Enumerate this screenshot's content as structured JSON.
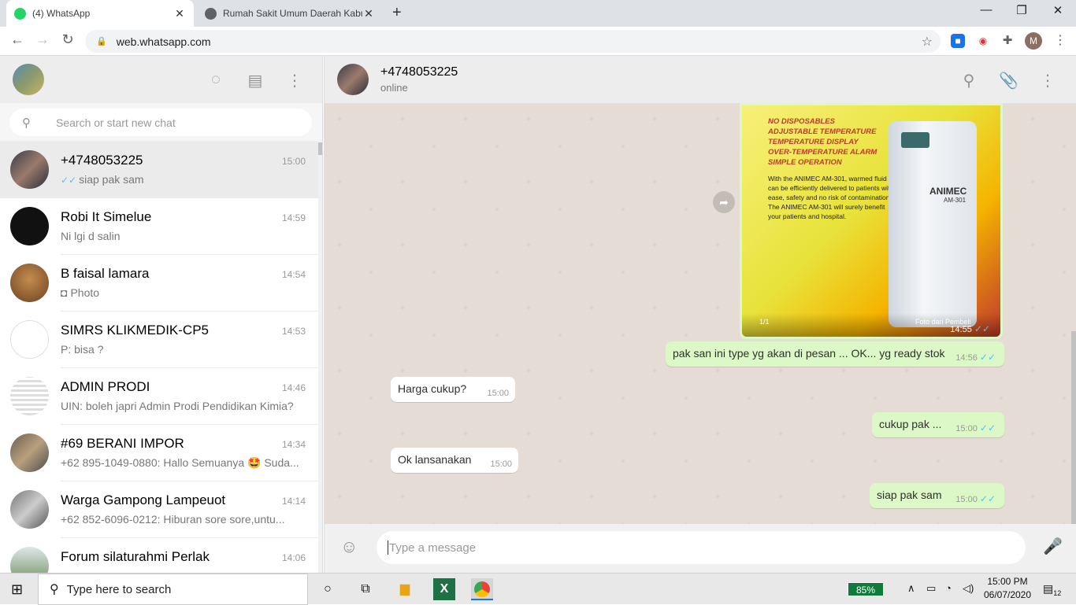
{
  "browser": {
    "tabs": [
      {
        "title": "(4) WhatsApp",
        "active": true
      },
      {
        "title": "Rumah Sakit Umum Daerah Kabu",
        "active": false
      }
    ],
    "new_tab": "+",
    "url": "web.whatsapp.com",
    "profile_initial": "M"
  },
  "sidebar": {
    "search_placeholder": "Search or start new chat",
    "chats": [
      {
        "name": "+4748053225",
        "time": "15:00",
        "preview": "siap pak sam",
        "ticks": "✓✓",
        "active": true
      },
      {
        "name": "Robi It Simelue",
        "time": "14:59",
        "preview": "Ni lgi d salin"
      },
      {
        "name": "B faisal lamara",
        "time": "14:54",
        "preview": "Photo",
        "photo": true
      },
      {
        "name": "SIMRS KLIKMEDIK-CP5",
        "time": "14:53",
        "preview": "P: bisa ?"
      },
      {
        "name": "ADMIN PRODI",
        "time": "14:46",
        "preview": "UIN: boleh japri Admin Prodi Pendidikan Kimia?"
      },
      {
        "name": "#69 BERANI IMPOR",
        "time": "14:34",
        "preview": "+62 895-1049-0880: Hallo Semuanya 🤩 Suda..."
      },
      {
        "name": "Warga Gampong Lampeuot",
        "time": "14:14",
        "preview": "+62 852-6096-0212: Hiburan sore sore,untu...",
        "photo": true
      },
      {
        "name": "Forum silaturahmi Perlak",
        "time": "14:06",
        "preview": ""
      }
    ]
  },
  "conversation": {
    "contact": "+4748053225",
    "status": "online",
    "image_message": {
      "headlines": [
        "NO DISPOSABLES",
        "ADJUSTABLE TEMPERATURE",
        "TEMPERATURE DISPLAY",
        "OVER-TEMPERATURE ALARM",
        "SIMPLE OPERATION"
      ],
      "body": "With the ANIMEC AM-301, warmed fluid can be efficiently delivered to patients with ease, safety and no risk of contamination. The ANIMEC AM-301 will surely benefit your patients and hospital.",
      "brand": "ANIMEC",
      "model": "AM-301",
      "counter": "1/1",
      "caption": "Foto dari Pembeli",
      "time": "14:55"
    },
    "messages": [
      {
        "dir": "out",
        "text": "pak san ini type yg akan di pesan ... OK... yg ready stok",
        "time": "14:56"
      },
      {
        "dir": "in",
        "text": "Harga cukup?",
        "time": "15:00"
      },
      {
        "dir": "out",
        "text": "cukup pak ...",
        "time": "15:00"
      },
      {
        "dir": "in",
        "text": "Ok lansanakan",
        "time": "15:00"
      },
      {
        "dir": "out",
        "text": "siap pak sam",
        "time": "15:00"
      }
    ],
    "input_placeholder": "Type a message"
  },
  "taskbar": {
    "search_placeholder": "Type here to search",
    "battery": "85%",
    "time": "15:00 PM",
    "date": "06/07/2020",
    "notifications": "12"
  }
}
